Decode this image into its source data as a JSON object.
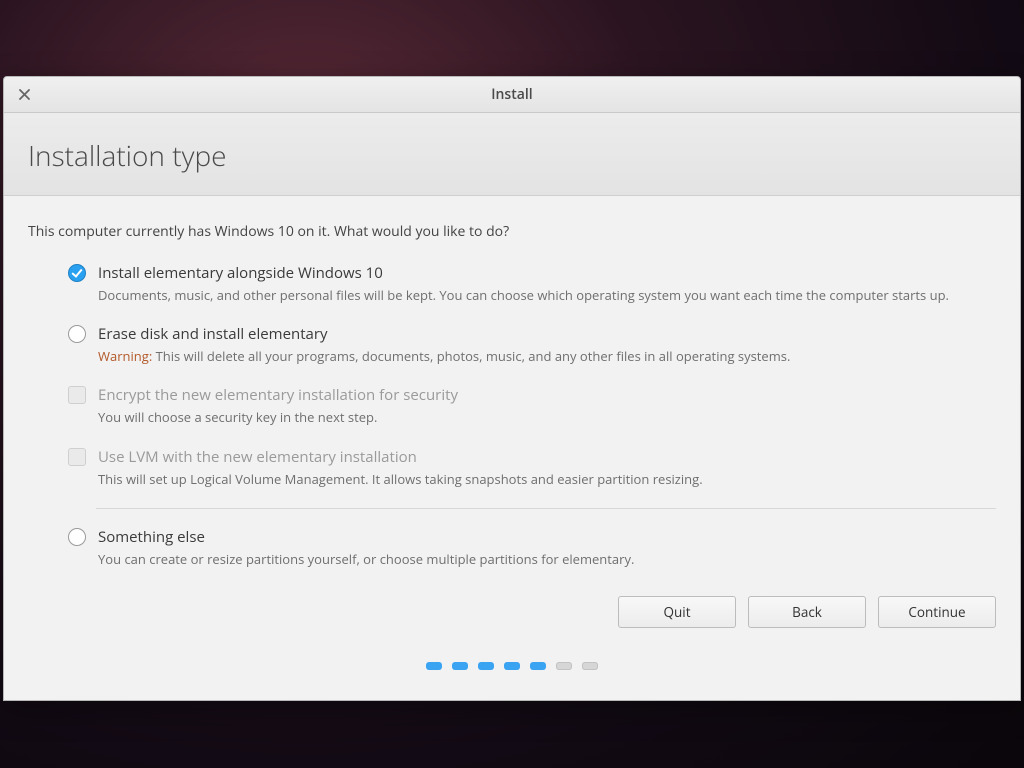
{
  "titlebar": {
    "title": "Install"
  },
  "header": {
    "title": "Installation type"
  },
  "intro": "This computer currently has Windows 10 on it. What would you like to do?",
  "options": {
    "alongside": {
      "label": "Install elementary alongside Windows 10",
      "desc": "Documents, music, and other personal files will be kept. You can choose which operating system you want each time the computer starts up."
    },
    "erase": {
      "label": "Erase disk and install elementary",
      "warn_prefix": "Warning:",
      "desc": " This will delete all your programs, documents, photos, music, and any other files in all operating systems."
    },
    "encrypt": {
      "label": "Encrypt the new elementary installation for security",
      "desc": "You will choose a security key in the next step."
    },
    "lvm": {
      "label": "Use LVM with the new elementary installation",
      "desc": "This will set up Logical Volume Management. It allows taking snapshots and easier partition resizing."
    },
    "something": {
      "label": "Something else",
      "desc": "You can create or resize partitions yourself, or choose multiple partitions for elementary."
    }
  },
  "buttons": {
    "quit": "Quit",
    "back": "Back",
    "continue": "Continue"
  },
  "progress": {
    "total": 7,
    "current": 5
  }
}
